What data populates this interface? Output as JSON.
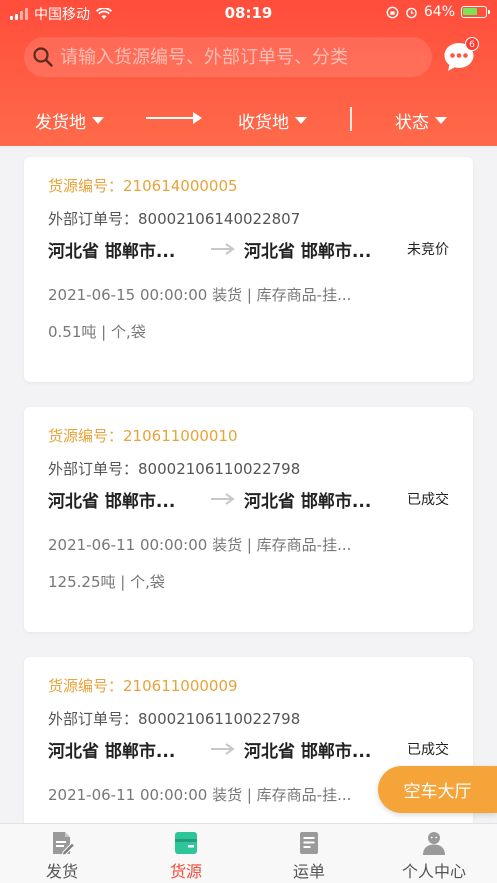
{
  "status_bar": {
    "carrier": "中国移动",
    "time": "08:19",
    "battery": "64%"
  },
  "search": {
    "placeholder": "请输入货源编号、外部订单号、分类",
    "message_badge": "6"
  },
  "filters": {
    "origin": "发货地",
    "destination": "收货地",
    "status": "状态"
  },
  "cards": [
    {
      "source_no_label": "货源编号：",
      "source_no": "210614000005",
      "ext_no_label": "外部订单号：",
      "ext_no": "80002106140022807",
      "from": "河北省 邯郸市...",
      "to": "河北省 邯郸市...",
      "status": "未竞价",
      "load": "2021-06-15 00:00:00 装货 | 库存商品-挂...",
      "weight": "0.51吨 |   个,袋"
    },
    {
      "source_no_label": "货源编号：",
      "source_no": "210611000010",
      "ext_no_label": "外部订单号：",
      "ext_no": "80002106110022798",
      "from": "河北省 邯郸市...",
      "to": "河北省 邯郸市...",
      "status": "已成交",
      "load": "2021-06-11 00:00:00 装货 | 库存商品-挂...",
      "weight": "125.25吨 |   个,袋"
    },
    {
      "source_no_label": "货源编号：",
      "source_no": "210611000009",
      "ext_no_label": "外部订单号：",
      "ext_no": "80002106110022798",
      "from": "河北省 邯郸市...",
      "to": "河北省 邯郸市...",
      "status": "已成交",
      "load": "2021-06-11 00:00:00 装货 | 库存商品-挂...",
      "weight": ""
    }
  ],
  "floating_button": "空车大厅",
  "tabs": [
    {
      "label": "发货",
      "icon": "document-edit-icon"
    },
    {
      "label": "货源",
      "icon": "cargo-box-icon",
      "active": true
    },
    {
      "label": "运单",
      "icon": "waybill-list-icon"
    },
    {
      "label": "个人中心",
      "icon": "user-profile-icon"
    }
  ],
  "colors": {
    "header": "#ff5640",
    "accent_orange": "#e8a33a",
    "active_tab": "#ef4a3b",
    "floating_button": "#f5a43a",
    "active_tab_icon": "#2fc59b"
  }
}
